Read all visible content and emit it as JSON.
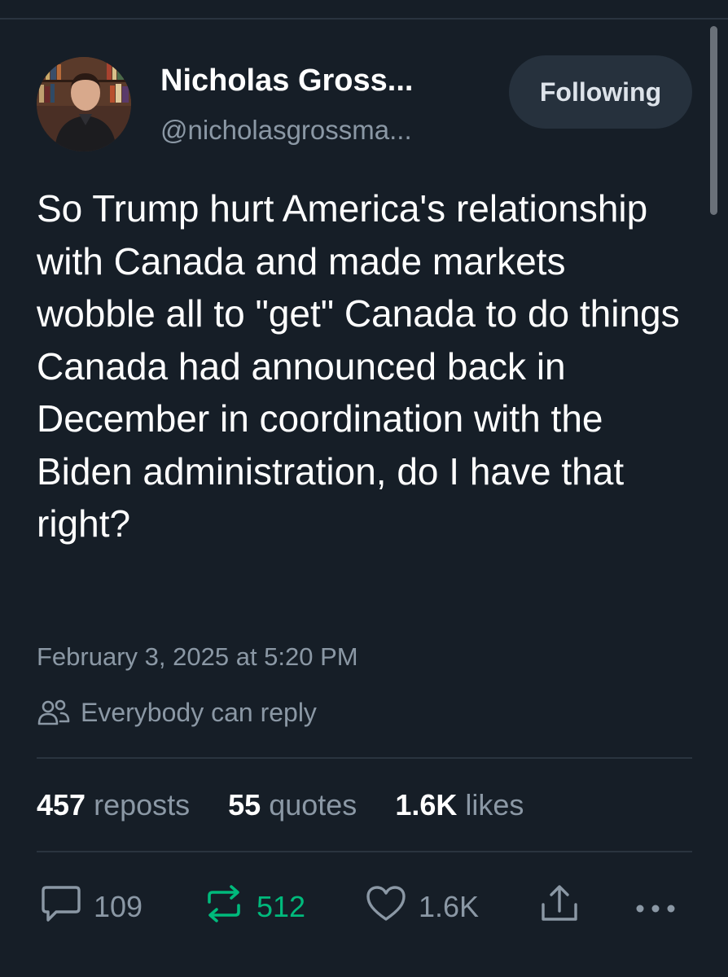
{
  "author": {
    "display_name": "Nicholas Gross...",
    "handle": "@nicholasgrossma...",
    "follow_label": "Following"
  },
  "tweet": {
    "text": "So Trump hurt America's relationship with Canada and made markets wobble all to \"get\" Canada to do things Canada had announced back in December in coordination with the Biden administration, do I have that right?",
    "timestamp": "February 3, 2025 at 5:20 PM",
    "reply_setting": "Everybody can reply"
  },
  "stats": {
    "reposts_count": "457",
    "reposts_label": "reposts",
    "quotes_count": "55",
    "quotes_label": "quotes",
    "likes_count": "1.6K",
    "likes_label": "likes"
  },
  "actions": {
    "reply_count": "109",
    "repost_count": "512",
    "like_count": "1.6K",
    "icons": [
      "reply-icon",
      "repost-icon",
      "like-icon",
      "share-icon",
      "more-icon"
    ]
  },
  "colors": {
    "background": "#161e27",
    "text_primary": "#ffffff",
    "text_secondary": "#8b98a5",
    "repost_active": "#00ba7c",
    "follow_button_bg": "#26313d",
    "divider": "#2a343f"
  }
}
